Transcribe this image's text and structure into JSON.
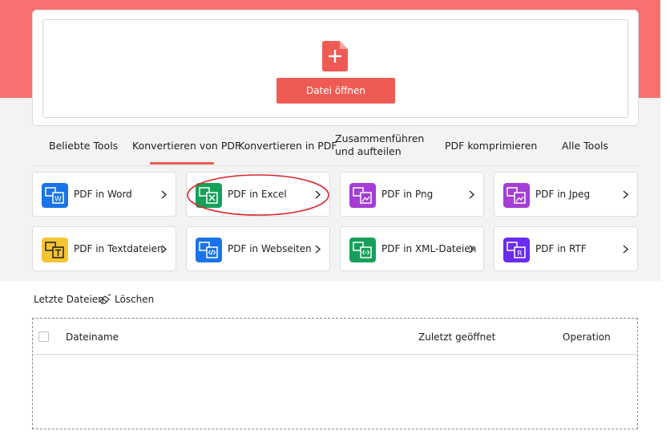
{
  "upload": {
    "button_label": "Datei öffnen",
    "icon": "file-add-icon",
    "accent_color": "#ef5b54"
  },
  "tabs": [
    {
      "label": "Beliebte Tools",
      "active": false
    },
    {
      "label": "Konvertieren von PDF",
      "active": true
    },
    {
      "label": "Konvertieren in PDF",
      "active": false
    },
    {
      "label": "Zusammenführen und aufteilen",
      "active": false
    },
    {
      "label": "PDF komprimieren",
      "active": false
    },
    {
      "label": "Alle Tools",
      "active": false
    }
  ],
  "tools": [
    {
      "label": "PDF in Word",
      "icon": "word-icon",
      "color": "#1a73e8"
    },
    {
      "label": "PDF in Excel",
      "icon": "excel-icon",
      "color": "#16a05a"
    },
    {
      "label": "PDF in Png",
      "icon": "png-icon",
      "color": "#a43ed4"
    },
    {
      "label": "PDF in Jpeg",
      "icon": "jpeg-icon",
      "color": "#a43ed4"
    },
    {
      "label": "PDF in Textdateien",
      "icon": "text-icon",
      "color": "#f5c431"
    },
    {
      "label": "PDF in Webseiten",
      "icon": "html-icon",
      "color": "#1a73e8"
    },
    {
      "label": "PDF in XML-Dateien",
      "icon": "xml-icon",
      "color": "#16a05a"
    },
    {
      "label": "PDF in RTF",
      "icon": "rtf-icon",
      "color": "#6a2cf0"
    }
  ],
  "recent": {
    "title": "Letzte Dateien",
    "clear_label": "Löschen",
    "columns": {
      "name": "Dateiname",
      "last_opened": "Zuletzt geöffnet",
      "operation": "Operation"
    },
    "rows": []
  },
  "highlight": {
    "target": "PDF in Excel",
    "color": "#d9262c"
  }
}
